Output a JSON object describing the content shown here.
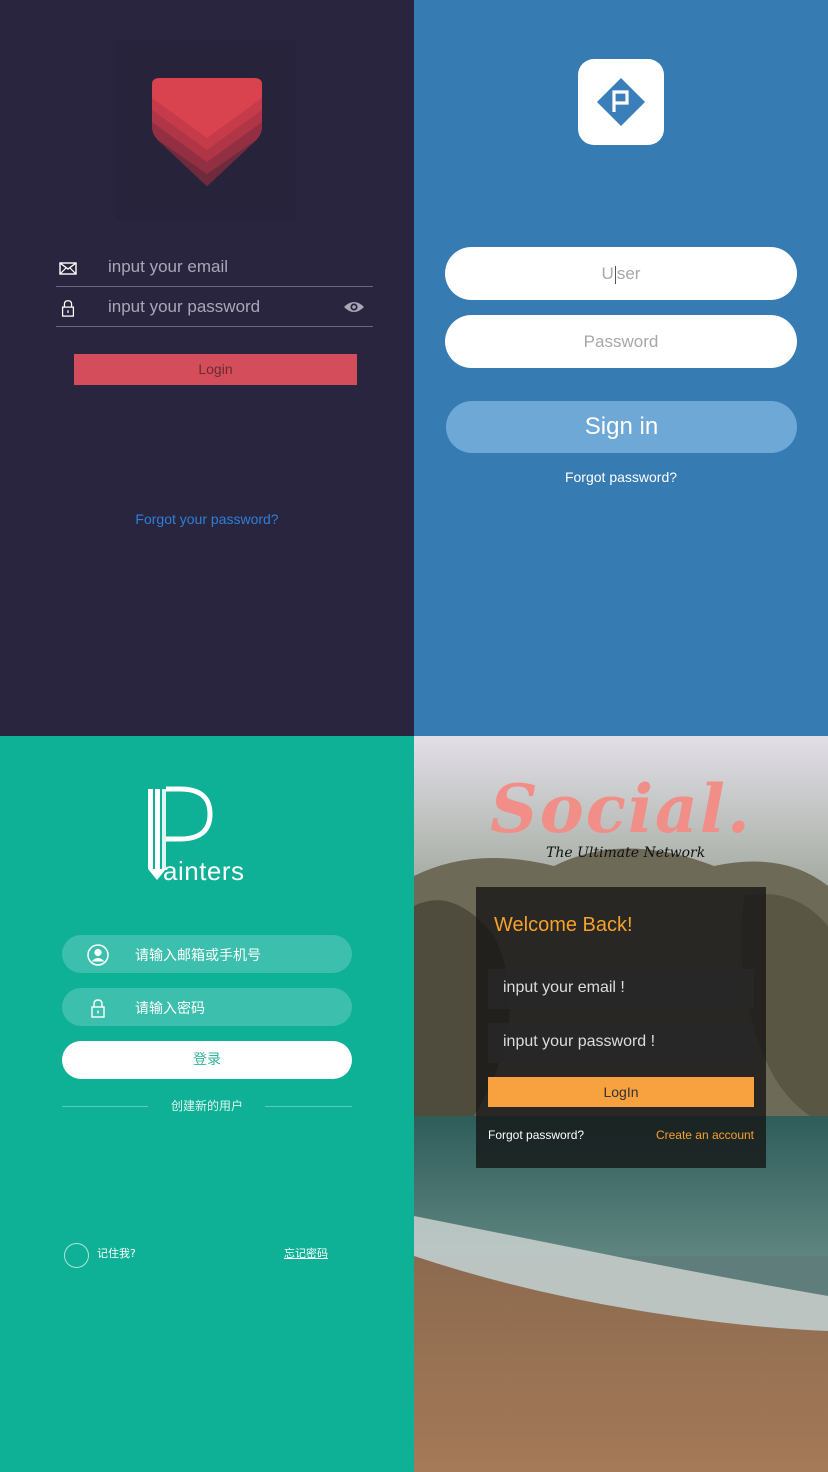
{
  "panel1": {
    "email_placeholder": "input your email",
    "password_placeholder": "input your password",
    "login_label": "Login",
    "forgot_label": "Forgot your password?",
    "colors": {
      "background": "#29253f",
      "accent": "#d44d5a",
      "link": "#2d7fd8"
    }
  },
  "panel2": {
    "user_placeholder_a": "U",
    "user_placeholder_b": "ser",
    "password_placeholder": "Password",
    "signin_label": "Sign in",
    "forgot_label": "Forgot password?",
    "colors": {
      "background": "#377bb3",
      "button": "#6ea8d6"
    }
  },
  "panel3": {
    "logo_word": "ainters",
    "account_placeholder": "请输入邮箱或手机号",
    "password_placeholder": "请输入密码",
    "login_label": "登录",
    "create_label": "创建新的用户",
    "remember_label": "记住我?",
    "forgot_label": "忘记密码",
    "colors": {
      "background": "#0eb096",
      "pill": "#3dbfad"
    }
  },
  "panel4": {
    "logo": "Social.",
    "tagline": "The Ultimate Network",
    "welcome": "Welcome Back!",
    "email_placeholder": "input your email !",
    "password_placeholder": "input your password !",
    "login_label": "LogIn",
    "forgot_label": "Forgot password?",
    "create_label": "Create an account",
    "colors": {
      "accent": "#f6a12c",
      "logo": "#f08e87"
    }
  },
  "icons": [
    "heart-logo-icon",
    "mail-icon",
    "lock-icon",
    "eye-icon",
    "app-logo-icon",
    "pencil-logo-icon",
    "user-icon",
    "lock-icon",
    "radio-icon"
  ]
}
